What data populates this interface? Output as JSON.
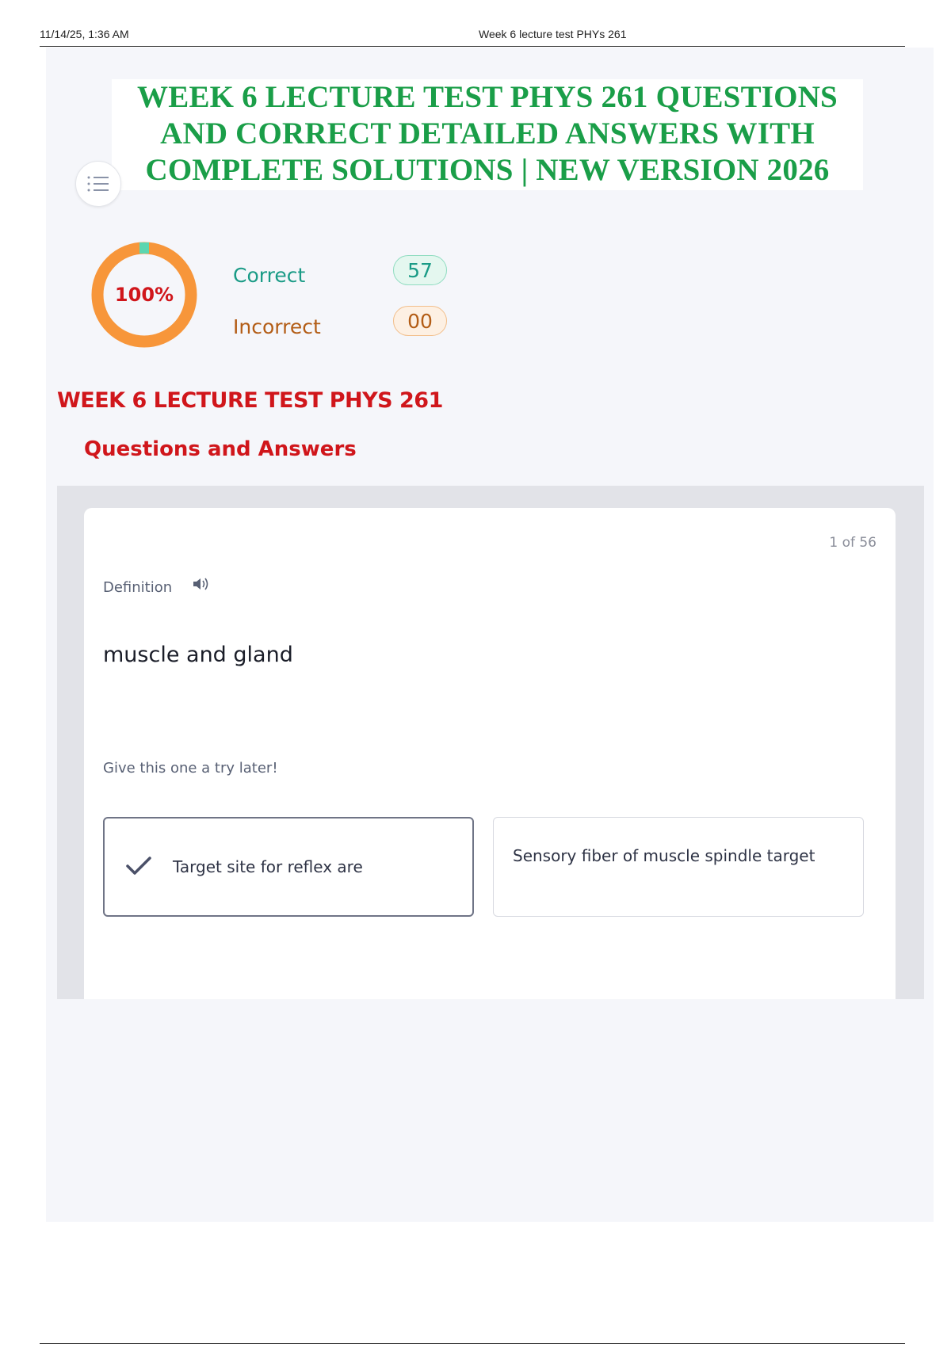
{
  "print_header": {
    "date": "11/14/25, 1:36 AM",
    "title": "Week 6 lecture test PHYs 261"
  },
  "banner": {
    "lines": [
      "WEEK 6 LECTURE TEST PHYS 261 QUESTIONS",
      "AND CORRECT DETAILED ANSWERS WITH",
      "COMPLETE SOLUTIONS | NEW VERSION 2026"
    ]
  },
  "menu": {
    "icon": "list-icon"
  },
  "score": {
    "percent_label": "100%",
    "percent_value": 100,
    "correct_label": "Correct",
    "correct_count": "57",
    "incorrect_label": "Incorrect",
    "incorrect_count": "00",
    "colors": {
      "ring": "#f7963a",
      "marker": "#5cd6b0",
      "correct": "#1a9b86",
      "incorrect": "#b35d16",
      "percent": "#d0161b"
    }
  },
  "section": {
    "title": "WEEK 6 LECTURE TEST PHYS 261",
    "subtitle": "Questions and Answers"
  },
  "card": {
    "counter": "1 of 56",
    "type_label": "Definition",
    "audio_icon": "speaker-icon",
    "term": "muscle and gland",
    "hint": "Give this one a try later!",
    "options": [
      {
        "text": "Target site for reflex are",
        "selected": true,
        "icon": "check-icon"
      },
      {
        "text": "Sensory fiber of muscle spindle target",
        "selected": false
      }
    ]
  }
}
